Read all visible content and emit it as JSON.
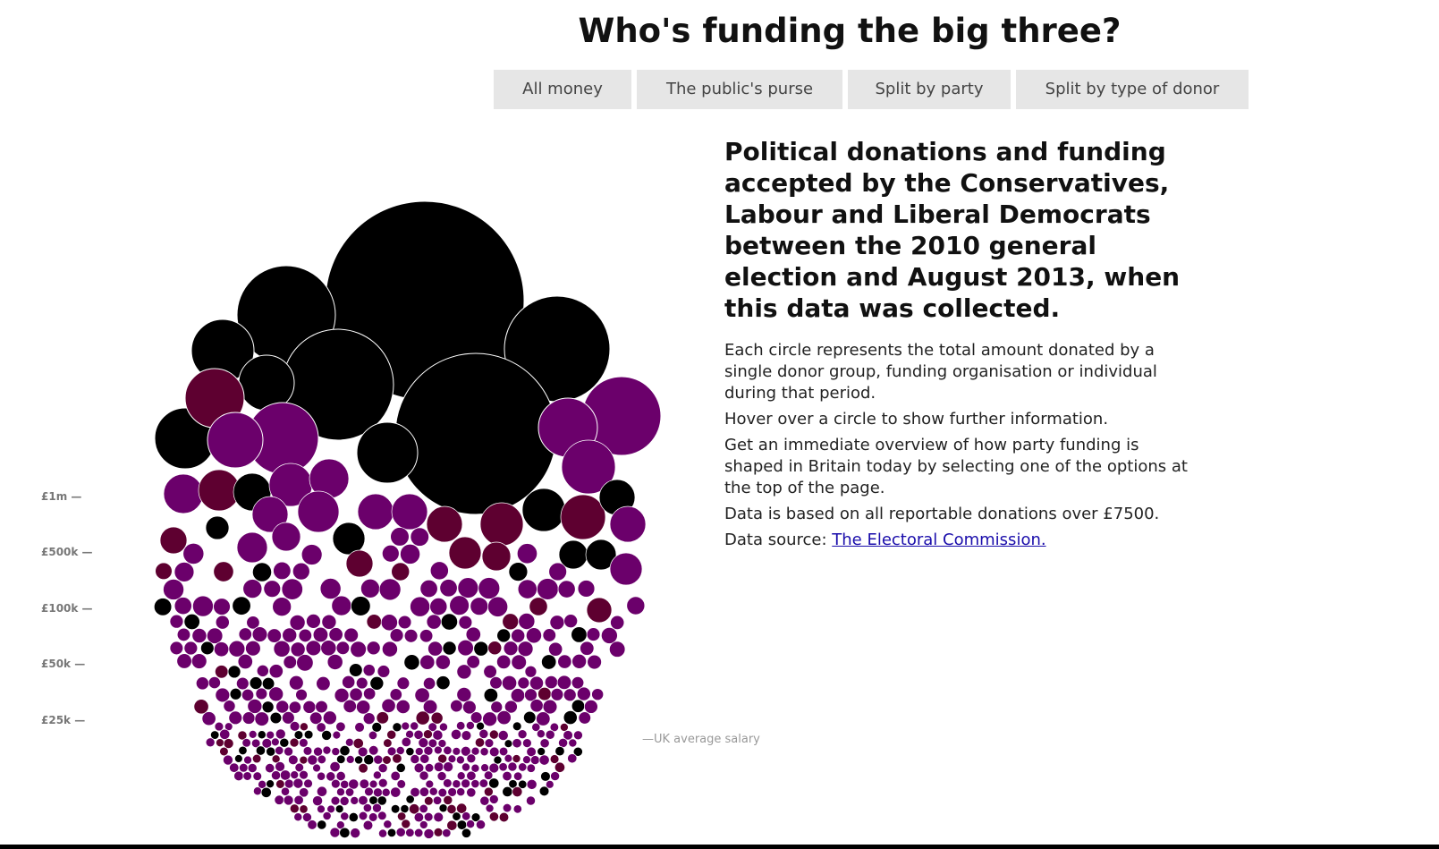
{
  "header": {
    "title": "Who's funding the big three?"
  },
  "tabs": [
    {
      "label": "All money"
    },
    {
      "label": "The public's purse"
    },
    {
      "label": "Split by party"
    },
    {
      "label": "Split by type of donor"
    }
  ],
  "description": {
    "headline": "Political donations and funding accepted by the Conservatives, Labour and Liberal Democrats between the 2010 general election and August 2013, when this data was collected.",
    "paragraphs": [
      "Each circle represents the total amount donated by a single donor group, funding organisation or individual during that period.",
      "Hover over a circle to show further information.",
      "Get an immediate overview of how party funding is shaped in Britain today by selecting one of the options at the top of the page.",
      "Data is based on all reportable donations over £7500."
    ],
    "source_prefix": "Data source: ",
    "source_link": "The Electoral Commission."
  },
  "colors": {
    "black": "#000000",
    "purple": "#6b006b",
    "maroon": "#5e0030",
    "tab_bg": "#e6e6e6",
    "link": "#1a0dab"
  },
  "chart_data": {
    "type": "bubble",
    "y_scale_ticks": [
      {
        "label": "£1m —",
        "value": 1000000
      },
      {
        "label": "£500k —",
        "value": 500000
      },
      {
        "label": "£100k —",
        "value": 100000
      },
      {
        "label": "£50k —",
        "value": 50000
      },
      {
        "label": "£25k —",
        "value": 25000
      }
    ],
    "reference_line": {
      "label": "—UK average salary",
      "value": 26000
    },
    "color_meaning": "",
    "large_circles": [
      {
        "color": "black",
        "rank": 1
      },
      {
        "color": "black",
        "rank": 2
      },
      {
        "color": "black",
        "rank": 3
      },
      {
        "color": "black",
        "rank": 4
      },
      {
        "color": "black",
        "rank": 5
      },
      {
        "color": "black",
        "rank": 6
      },
      {
        "color": "black",
        "rank": 7
      },
      {
        "color": "black",
        "rank": 8
      },
      {
        "color": "purple",
        "rank": 9
      },
      {
        "color": "purple",
        "rank": 10
      },
      {
        "color": "maroon",
        "rank": 11
      },
      {
        "color": "purple",
        "rank": 12
      }
    ]
  }
}
